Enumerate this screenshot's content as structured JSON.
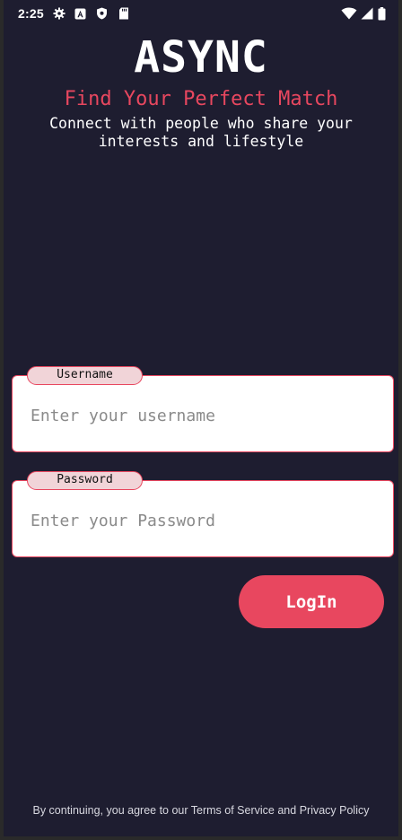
{
  "status_bar": {
    "time": "2:25",
    "icons_left": [
      "gear-icon",
      "a-badge-icon",
      "shield-icon",
      "sd-card-icon"
    ],
    "icons_right": [
      "wifi-icon",
      "signal-icon",
      "battery-icon"
    ]
  },
  "header": {
    "title": "ASYNC",
    "tagline": "Find Your Perfect Match",
    "subtitle": "Connect with people who share your interests and lifestyle"
  },
  "form": {
    "username": {
      "label": "Username",
      "placeholder": "Enter your username",
      "value": ""
    },
    "password": {
      "label": "Password",
      "placeholder": "Enter your Password",
      "value": ""
    },
    "login_label": "LogIn"
  },
  "footer": {
    "prefix": "By continuing, you agree to our ",
    "terms": "Terms of Service",
    "and": " and ",
    "privacy": "Privacy Policy"
  },
  "colors": {
    "background": "#1e1d30",
    "accent": "#e8475f",
    "label_bg": "#f1d4d8",
    "field_bg": "#ffffff"
  }
}
